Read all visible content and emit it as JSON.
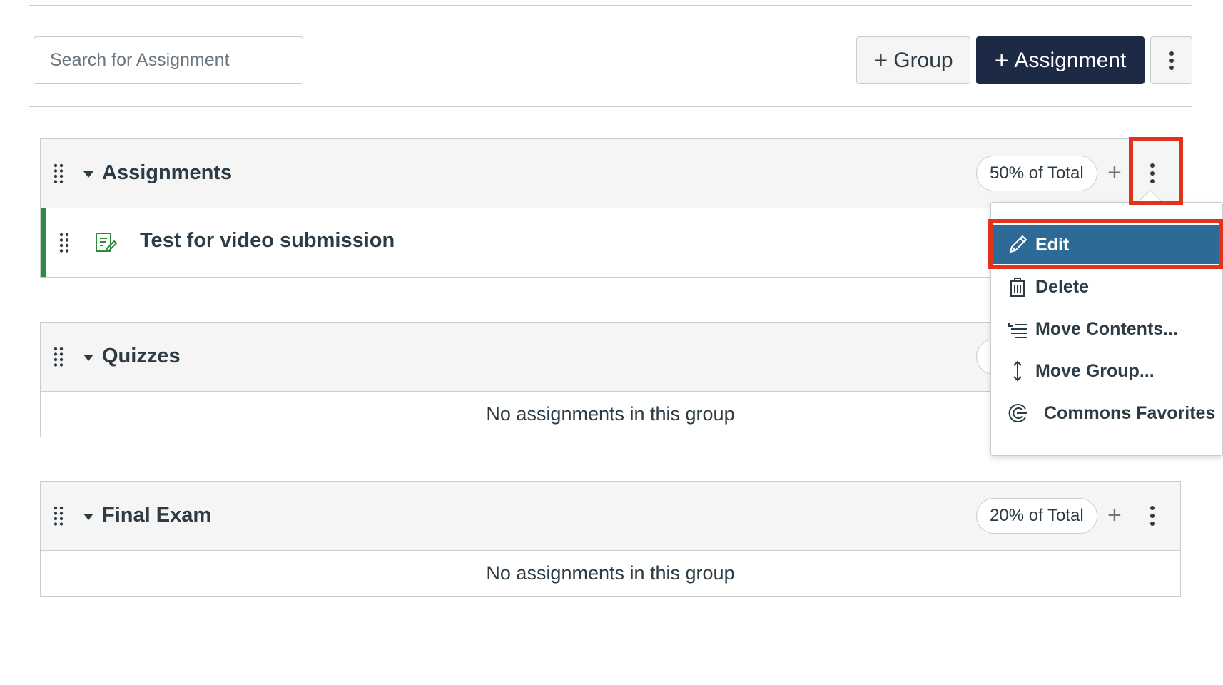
{
  "toolbar": {
    "search_placeholder": "Search for Assignment",
    "group_button_label": "Group",
    "assignment_button_label": "Assignment"
  },
  "groups": [
    {
      "title": "Assignments",
      "weight": "50% of Total",
      "items": [
        {
          "title": "Test for video submission",
          "icon": "assignment-icon"
        }
      ]
    },
    {
      "title": "Quizzes",
      "weight": "",
      "empty_text": "No assignments in this group"
    },
    {
      "title": "Final Exam",
      "weight": "20% of Total",
      "empty_text": "No assignments in this group"
    }
  ],
  "menu": {
    "items": [
      {
        "label": "Edit",
        "icon": "pencil-icon",
        "active": true
      },
      {
        "label": "Delete",
        "icon": "trash-icon"
      },
      {
        "label": "Move Contents...",
        "icon": "move-contents-icon"
      },
      {
        "label": "Move Group...",
        "icon": "move-vertical-icon"
      },
      {
        "label": "Commons Favorites",
        "icon": "commons-icon"
      }
    ]
  },
  "colors": {
    "primary_button": "#1c2a45",
    "menu_active": "#2d6a96",
    "highlight": "#e0331e",
    "published_accent": "#2d8a3e"
  }
}
